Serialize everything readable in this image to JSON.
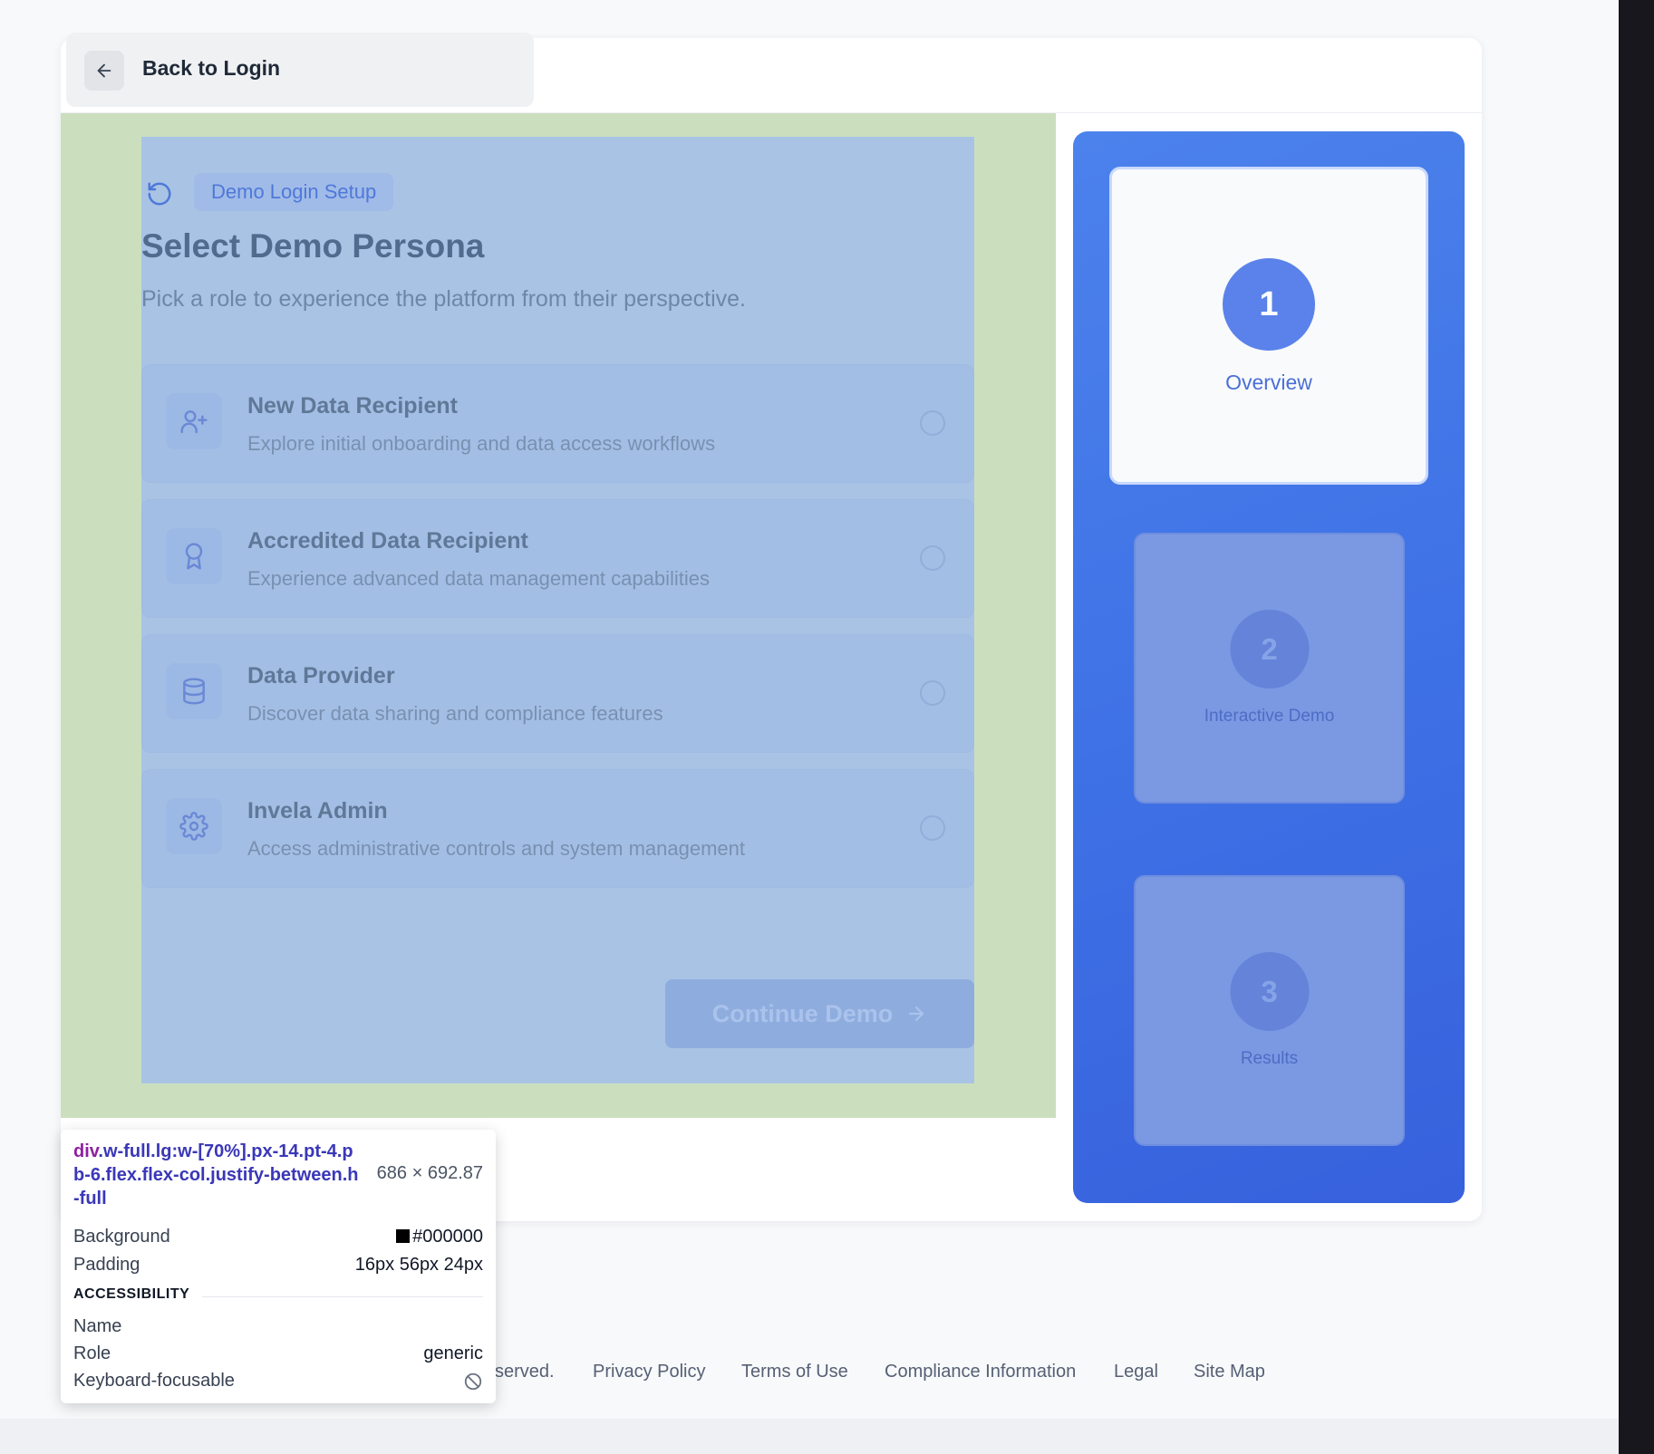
{
  "header": {
    "back_label": "Back to Login"
  },
  "main": {
    "badge": "Demo Login Setup",
    "title": "Select Demo Persona",
    "subtitle": "Pick a role to experience the platform from their perspective.",
    "personas": [
      {
        "title": "New Data Recipient",
        "description": "Explore initial onboarding and data access workflows",
        "icon": "user-plus-icon"
      },
      {
        "title": "Accredited Data Recipient",
        "description": "Experience advanced data management capabilities",
        "icon": "award-icon"
      },
      {
        "title": "Data Provider",
        "description": "Discover data sharing and compliance features",
        "icon": "database-icon"
      },
      {
        "title": "Invela Admin",
        "description": "Access administrative controls and system management",
        "icon": "gear-icon"
      }
    ],
    "continue_label": "Continue Demo"
  },
  "steps": [
    {
      "number": "1",
      "label": "Overview",
      "active": true
    },
    {
      "number": "2",
      "label": "Interactive Demo",
      "active": false
    },
    {
      "number": "3",
      "label": "Results",
      "active": false
    }
  ],
  "devtools_tooltip": {
    "tag": "div",
    "selector": ".w-full.lg:w-[70%].px-14.pt-4.pb-6.flex.flex-col.justify-between.h-full",
    "size": "686 × 692.87",
    "background_label": "Background",
    "background_value": "#000000",
    "padding_label": "Padding",
    "padding_value": "16px 56px 24px",
    "accessibility_heading": "ACCESSIBILITY",
    "name_label": "Name",
    "role_label": "Role",
    "role_value": "generic",
    "focusable_label": "Keyboard-focusable"
  },
  "footer": {
    "rights_fragment": "served.",
    "links": [
      "Privacy Policy",
      "Terms of Use",
      "Compliance Information",
      "Legal",
      "Site Map"
    ]
  },
  "colors": {
    "accent": "#4a7ae8",
    "highlight_margin": "#cbdfbe",
    "highlight_content": "#a9c3e5"
  }
}
